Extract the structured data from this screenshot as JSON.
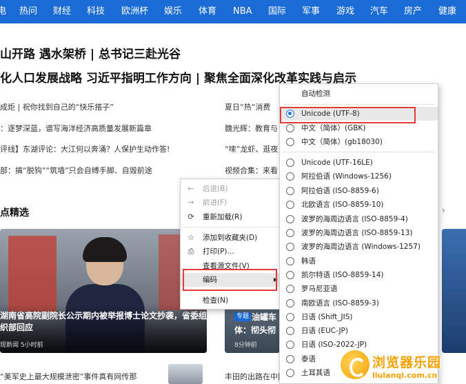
{
  "nav": {
    "items": [
      "电",
      "热问",
      "财经",
      "科技",
      "欧洲杯",
      "娱乐",
      "体育",
      "NBA",
      "国际",
      "军事",
      "游戏",
      "汽车",
      "房产",
      "健康"
    ]
  },
  "headlines": {
    "line1": "山开路 遇水架桥 | 总书记三赴光谷",
    "line2": "化人口发展战略 习近平指明工作方向 | 聚焦全面深化改革实践与启示"
  },
  "news_left": [
    "成炬 | 祝你找到自己的“快乐搭子”",
    "：逐梦深蓝，谱写海洋经济高质量发展新篇章",
    "评线】东湖评论：大江何以奔涌？人保护生动作答!",
    "部：搞“脱钩”“筑墙”只会自缚手脚、自毁前途"
  ],
  "news_right": [
    "夏日“热”消费",
    "魏光辉：教育与",
    "“嗦”龙虾、逛夜",
    "视频合集：来看"
  ],
  "section": {
    "title": "点精选"
  },
  "card_main": {
    "title": "湖南省高院副院长公示期内被举报博士论文抄袭，省委组织部回应",
    "meta": "现新闻 5小时前"
  },
  "card_second": {
    "tag": "专题",
    "title_line1": "油罐车",
    "title_line2": "体：彻头彻",
    "meta": "8分钟前"
  },
  "bottom": {
    "left": "“美军史上最大规模泄密”事件真有网传那",
    "right": "丰田的出路在中国 ..."
  },
  "context_menu": {
    "items": [
      {
        "label": "后退(B)",
        "icon": "←",
        "disabled": true
      },
      {
        "label": "前进(F)",
        "icon": "→",
        "disabled": true
      },
      {
        "label": "重新加载(R)",
        "icon": "⟳",
        "disabled": false
      },
      {
        "label": "添加到收藏夹(D)",
        "icon": "☆",
        "disabled": false
      },
      {
        "label": "打印(P)...",
        "icon": "⎙",
        "disabled": false
      },
      {
        "label": "查看源文件(V)",
        "icon": "",
        "disabled": false
      },
      {
        "label": "编码",
        "icon": "",
        "disabled": false,
        "submenu": true
      },
      {
        "label": "检查(N)",
        "icon": "",
        "disabled": false
      }
    ]
  },
  "encoding_menu": {
    "auto_detect": "自动检测",
    "selected": "Unicode (UTF-8)",
    "items": [
      "Unicode (UTF-8)",
      "中文（简体）(GBK)",
      "中文（简体）(gb18030)",
      "Unicode (UTF-16LE)",
      "阿拉伯语 (Windows-1256)",
      "阿拉伯语 (ISO-8859-6)",
      "北欧语言 (ISO-8859-10)",
      "波罗的海周边语言 (ISO-8859-4)",
      "波罗的海周边语言 (ISO-8859-13)",
      "波罗的海周边语言 (Windows-1257)",
      "韩语",
      "凯尔特语 (ISO-8859-14)",
      "罗马尼亚语",
      "南欧语言 (ISO-8859-3)",
      "日语 (Shift_JIS)",
      "日语 (EUC-JP)",
      "日语 (ISO-2022-JP)",
      "泰语",
      "土耳其语"
    ]
  },
  "watermark": {
    "title": "浏览器乐园",
    "url": "liulanqi.com.cn"
  },
  "colors": {
    "nav_bg": "#1a6bd6",
    "highlight_border": "#e53a3a",
    "radio_checked": "#1a73e8",
    "watermark": "#f5a100"
  }
}
